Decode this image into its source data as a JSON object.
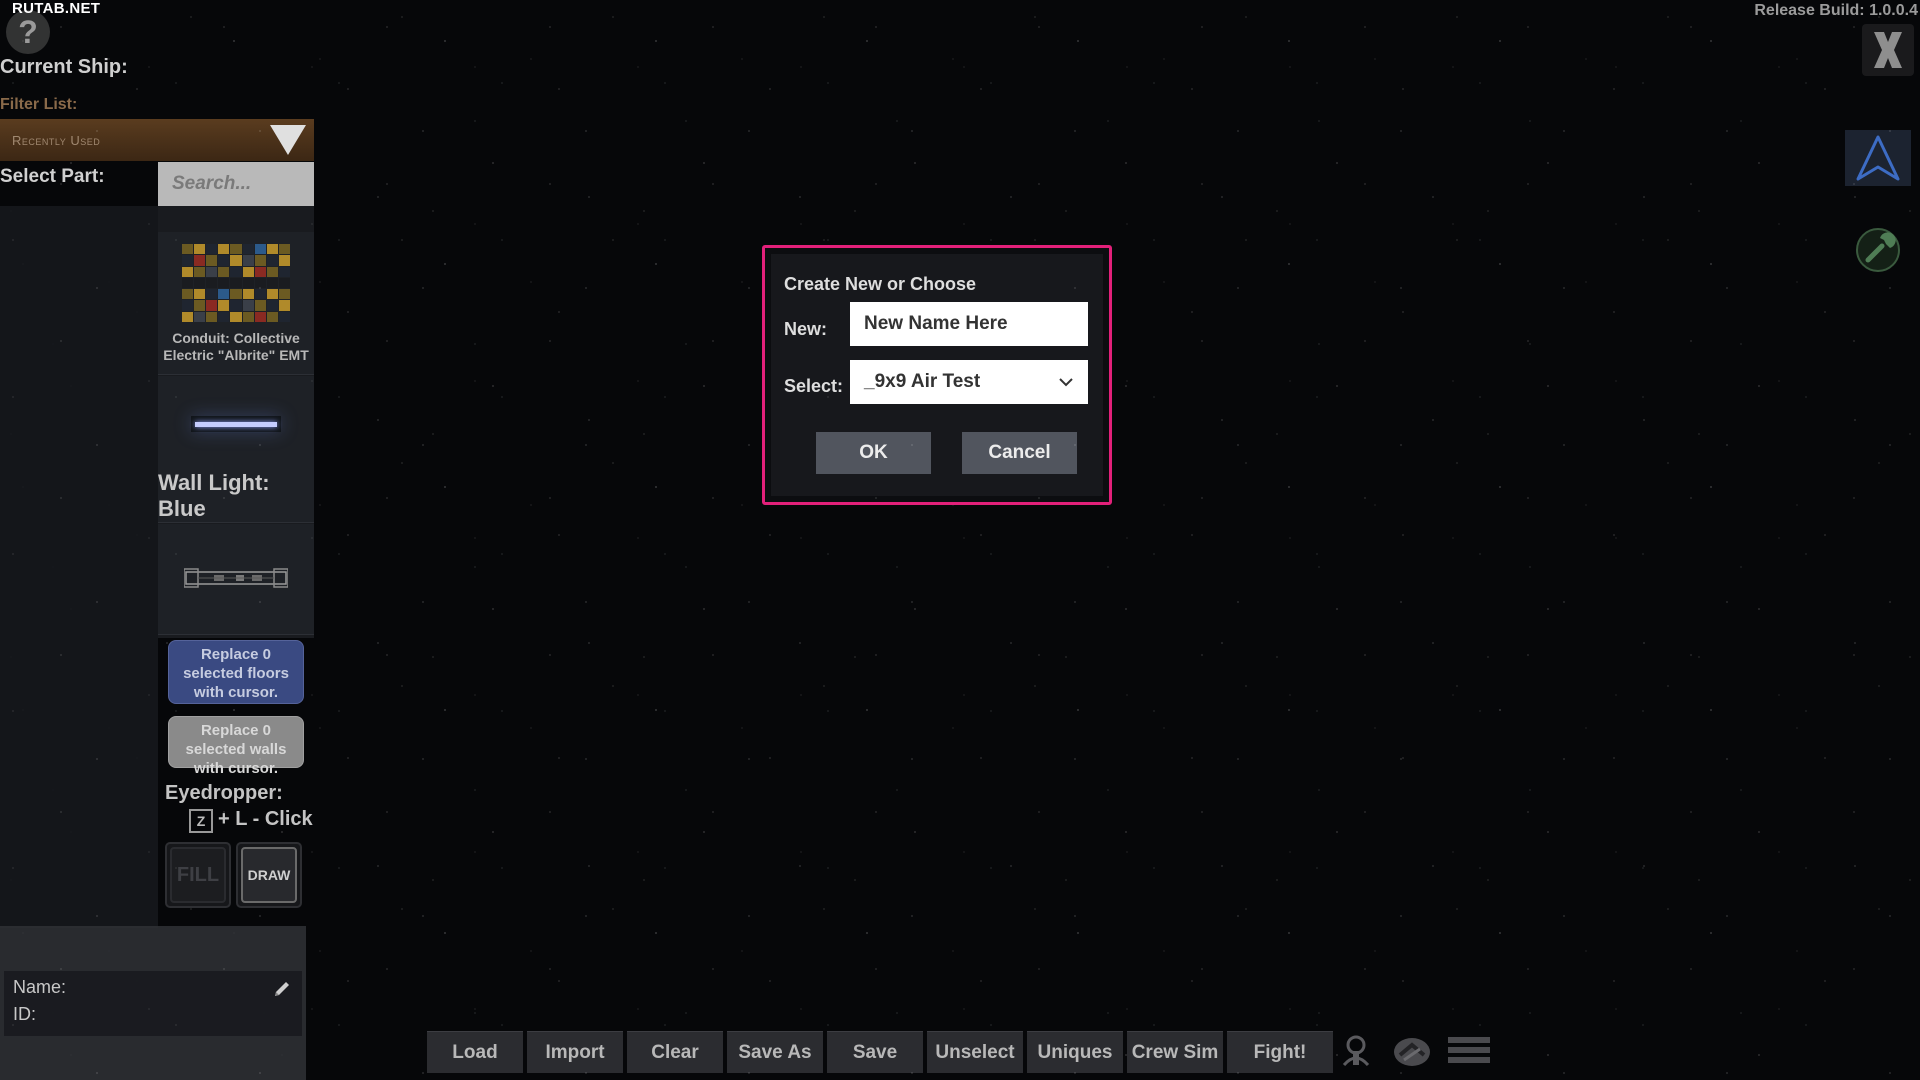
{
  "watermark": "RUTAB.NET",
  "help": {
    "glyph": "?"
  },
  "sidebar": {
    "current_ship_label": "Current Ship:",
    "filter_label": "Filter List:",
    "filter_value": "Recently Used",
    "select_part_label": "Select Part:",
    "search_placeholder": "Search...",
    "parts": [
      {
        "name": "Conduit: Collective Electric \"Albrite\" EMT"
      },
      {
        "name": "Wall Light: Blue"
      },
      {
        "name": ""
      }
    ],
    "replace_floors": "Replace 0 selected floors with cursor.",
    "replace_walls": "Replace 0 selected walls with cursor.",
    "eyedropper_label": "Eyedropper:",
    "eyedropper_key": "Z",
    "eyedropper_hint": "+ L - Click",
    "fill_label": "FILL",
    "draw_label": "DRAW",
    "info_name_label": "Name:",
    "info_id_label": "ID:"
  },
  "header": {
    "release_build": "Release Build: 1.0.0.4",
    "close_glyph": "X"
  },
  "toolbar": {
    "buttons": [
      "Load",
      "Import",
      "Clear",
      "Save As",
      "Save",
      "Unselect",
      "Uniques",
      "Crew Sim",
      "Fight!"
    ]
  },
  "dialog": {
    "title": "Create New or Choose",
    "new_label": "New:",
    "new_value": "New Name Here",
    "select_label": "Select:",
    "select_value": "_9x9 Air Test",
    "ok_label": "OK",
    "cancel_label": "Cancel"
  },
  "colors": {
    "accent_dialog_border": "#e2207a",
    "filter_dropdown": "#5a3c1f",
    "replace_floors_button": "#3a4a82",
    "toolbar_button": "#2b2c30"
  },
  "icons": {
    "help": "question-mark-icon",
    "filter_toggle": "triangle-down-icon",
    "close": "close-icon",
    "navigation": "nav-arrow-icon",
    "build": "wrench-icon",
    "edit": "pencil-icon",
    "select_toggle": "chevron-down-icon",
    "crew": "crew-icon",
    "link": "link-icon",
    "menu": "menu-lines-icon"
  }
}
